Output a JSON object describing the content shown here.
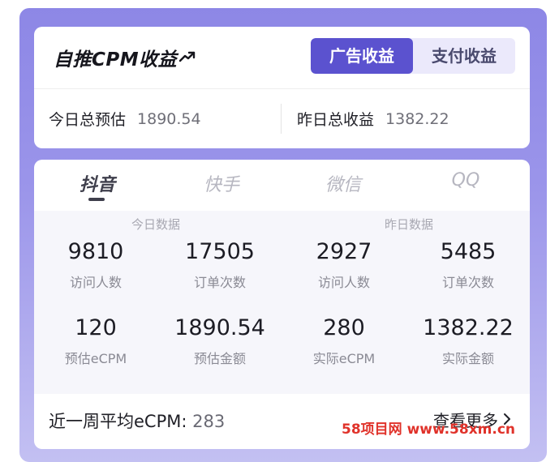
{
  "header": {
    "title": "自推CPM收益",
    "tabs": [
      "广告收益",
      "支付收益"
    ],
    "active_tab": 0
  },
  "summary": {
    "today_label": "今日总预估",
    "today_value": "1890.54",
    "yesterday_label": "昨日总收益",
    "yesterday_value": "1382.22"
  },
  "platform_tabs": [
    "抖音",
    "快手",
    "微信",
    "QQ"
  ],
  "stats": {
    "today_label": "今日数据",
    "yesterday_label": "昨日数据",
    "items": [
      {
        "value": "9810",
        "label": "访问人数"
      },
      {
        "value": "17505",
        "label": "订单次数"
      },
      {
        "value": "2927",
        "label": "访问人数"
      },
      {
        "value": "5485",
        "label": "订单次数"
      },
      {
        "value": "120",
        "label": "预估eCPM"
      },
      {
        "value": "1890.54",
        "label": "预估金额"
      },
      {
        "value": "280",
        "label": "实际eCPM"
      },
      {
        "value": "1382.22",
        "label": "实际金额"
      }
    ]
  },
  "footer": {
    "avg_label": "近一周平均eCPM:",
    "avg_value": "283",
    "more_label": "查看更多"
  },
  "watermark": "58项目网 www.58xm.cn",
  "colors": {
    "accent": "#5b52cf",
    "frame": "#8d87e6"
  }
}
